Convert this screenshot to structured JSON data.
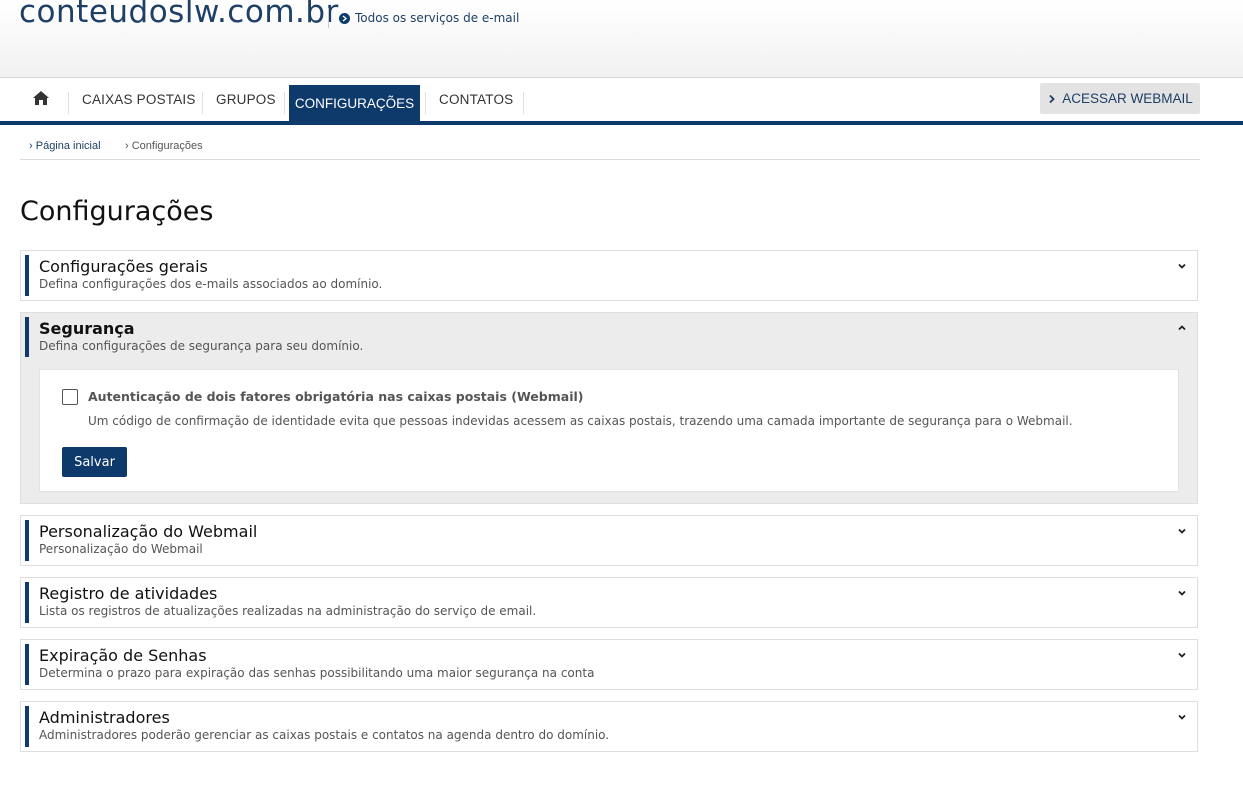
{
  "header": {
    "logo": "conteudoslw.com.br",
    "all_services": "Todos os serviços de e-mail"
  },
  "nav": {
    "items": [
      "CAIXAS POSTAIS",
      "GRUPOS",
      "CONFIGURAÇÕES",
      "CONTATOS"
    ],
    "active": "CONFIGURAÇÕES",
    "webmail_button": "ACESSAR WEBMAIL"
  },
  "breadcrumb": {
    "home": "Página inicial",
    "current": "Configurações"
  },
  "page_title": "Configurações",
  "sections": [
    {
      "title": "Configurações gerais",
      "desc": "Defina configurações dos e-mails associados ao domínio.",
      "expanded": false
    },
    {
      "title": "Segurança",
      "desc": "Defina configurações de segurança para seu domínio.",
      "expanded": true
    },
    {
      "title": "Personalização do Webmail",
      "desc": "Personalização do Webmail",
      "expanded": false
    },
    {
      "title": "Registro de atividades",
      "desc": "Lista os registros de atualizações realizadas na administração do serviço de email.",
      "expanded": false
    },
    {
      "title": "Expiração de Senhas",
      "desc": "Determina o prazo para expiração das senhas possibilitando uma maior segurança na conta",
      "expanded": false
    },
    {
      "title": "Administradores",
      "desc": "Administradores poderão gerenciar as caixas postais e contatos na agenda dentro do domínio.",
      "expanded": false
    }
  ],
  "security": {
    "checkbox_label": "Autenticação de dois fatores obrigatória nas caixas postais (Webmail)",
    "checkbox_checked": false,
    "checkbox_desc": "Um código de confirmação de identidade evita que pessoas indevidas acessem as caixas postais, trazendo uma camada importante de segurança para o Webmail.",
    "save_label": "Salvar"
  },
  "colors": {
    "brand": "#0d3a6b",
    "logo": "#1e3f66"
  }
}
